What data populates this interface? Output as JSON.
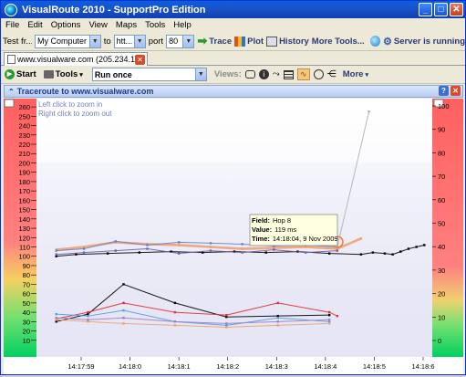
{
  "window": {
    "title": "VisualRoute 2010 - SupportPro Edition",
    "min": "_",
    "max": "□",
    "close": "✕"
  },
  "menu": [
    "File",
    "Edit",
    "Options",
    "View",
    "Maps",
    "Tools",
    "Help"
  ],
  "toolbar": {
    "test_from_label": "Test fr...",
    "test_from_value": "My Computer",
    "to_label": "to",
    "to_value": "htt...",
    "port_label": "port",
    "port_value": "80",
    "trace_label": "Trace",
    "plot_label": "Plot",
    "history_label": "History",
    "more_tools_label": "More Tools...",
    "server_status": "Server is running"
  },
  "tab": {
    "label": "www.visualware.com (205.234.11..."
  },
  "toolbar2": {
    "start_label": "Start",
    "tools_label": "Tools",
    "run_mode": "Run once",
    "views_label": "Views:",
    "more_label": "More"
  },
  "panel": {
    "title": "Traceroute to www.visualware.com"
  },
  "chart_hint": {
    "line1": "Left click to zoom in",
    "line2": "Right click to zoom out"
  },
  "tooltip": {
    "field_label": "Field:",
    "field_value": "Hop 8",
    "value_label": "Value:",
    "value_value": "119 ms",
    "time_label": "Time:",
    "time_value": "14:18:04, 9 Nov 2009"
  },
  "colors": {
    "low": "#00c060",
    "high": "#ff4040",
    "accent": "#1b3b8a"
  },
  "chart_data": {
    "type": "line",
    "y_left_ticks": [
      10,
      20,
      30,
      40,
      50,
      60,
      70,
      80,
      90,
      100,
      110,
      120,
      130,
      140,
      150,
      160,
      170,
      180,
      190,
      200,
      210,
      220,
      230,
      240,
      250,
      260
    ],
    "y_right_ticks": [
      "0",
      "10",
      "20",
      "30",
      "40",
      "50",
      "60",
      "70",
      "80",
      "90",
      "100"
    ],
    "x_ticks": [
      "14:17:59",
      "14:18:0",
      "14:18:1",
      "14:18:2",
      "14:18:3",
      "14:18:4",
      "14:18:5",
      "14:18:6"
    ],
    "ylim": [
      0,
      265
    ],
    "series": [
      {
        "color": "#000000",
        "points": [
          [
            0.05,
            100
          ],
          [
            0.1,
            102
          ],
          [
            0.18,
            103
          ],
          [
            0.26,
            104
          ],
          [
            0.34,
            105
          ],
          [
            0.42,
            104
          ],
          [
            0.5,
            105
          ],
          [
            0.58,
            104
          ],
          [
            0.66,
            105
          ],
          [
            0.74,
            103
          ],
          [
            0.82,
            102
          ],
          [
            0.85,
            104
          ],
          [
            0.88,
            103
          ],
          [
            0.9,
            102
          ],
          [
            0.92,
            105
          ],
          [
            0.94,
            108
          ],
          [
            0.96,
            110
          ],
          [
            0.98,
            112
          ]
        ]
      },
      {
        "color": "#f0a070",
        "points": [
          [
            0.05,
            107
          ],
          [
            0.12,
            110
          ],
          [
            0.2,
            115
          ],
          [
            0.28,
            113
          ],
          [
            0.36,
            112
          ],
          [
            0.44,
            110
          ],
          [
            0.52,
            108
          ],
          [
            0.6,
            109
          ],
          [
            0.68,
            110
          ],
          [
            0.76,
            108
          ],
          [
            0.82,
            119
          ]
        ]
      },
      {
        "color": "#6080d0",
        "points": [
          [
            0.05,
            106
          ],
          [
            0.12,
            108
          ],
          [
            0.2,
            116
          ],
          [
            0.28,
            112
          ],
          [
            0.36,
            115
          ],
          [
            0.44,
            114
          ],
          [
            0.52,
            113
          ],
          [
            0.6,
            111
          ],
          [
            0.68,
            112
          ],
          [
            0.76,
            110
          ]
        ]
      },
      {
        "color": "#7060a0",
        "points": [
          [
            0.05,
            102
          ],
          [
            0.12,
            104
          ],
          [
            0.2,
            106
          ],
          [
            0.28,
            108
          ],
          [
            0.36,
            103
          ],
          [
            0.44,
            106
          ],
          [
            0.52,
            104
          ],
          [
            0.6,
            107
          ],
          [
            0.68,
            104
          ],
          [
            0.76,
            106
          ]
        ]
      },
      {
        "color": "#b0b0b0",
        "points": [
          [
            0.76,
            110
          ],
          [
            0.84,
            255
          ]
        ]
      },
      {
        "color": "#000000",
        "points": [
          [
            0.05,
            30
          ],
          [
            0.13,
            38
          ],
          [
            0.22,
            70
          ],
          [
            0.35,
            50
          ],
          [
            0.48,
            35
          ],
          [
            0.61,
            36
          ],
          [
            0.74,
            37
          ]
        ]
      },
      {
        "color": "#e03030",
        "points": [
          [
            0.05,
            33
          ],
          [
            0.13,
            40
          ],
          [
            0.22,
            50
          ],
          [
            0.35,
            40
          ],
          [
            0.48,
            37
          ],
          [
            0.61,
            50
          ],
          [
            0.74,
            40
          ],
          [
            0.76,
            36
          ]
        ]
      },
      {
        "color": "#50a0e0",
        "points": [
          [
            0.05,
            38
          ],
          [
            0.13,
            36
          ],
          [
            0.22,
            42
          ],
          [
            0.35,
            30
          ],
          [
            0.48,
            26
          ],
          [
            0.61,
            34
          ],
          [
            0.74,
            30
          ]
        ]
      },
      {
        "color": "#f0a070",
        "points": [
          [
            0.05,
            32
          ],
          [
            0.13,
            30
          ],
          [
            0.22,
            28
          ],
          [
            0.35,
            26
          ],
          [
            0.48,
            24
          ],
          [
            0.61,
            26
          ],
          [
            0.74,
            28
          ]
        ]
      },
      {
        "color": "#a080c0",
        "points": [
          [
            0.05,
            34
          ],
          [
            0.13,
            32
          ],
          [
            0.22,
            34
          ],
          [
            0.35,
            30
          ],
          [
            0.48,
            28
          ],
          [
            0.61,
            30
          ],
          [
            0.74,
            32
          ]
        ]
      }
    ]
  }
}
